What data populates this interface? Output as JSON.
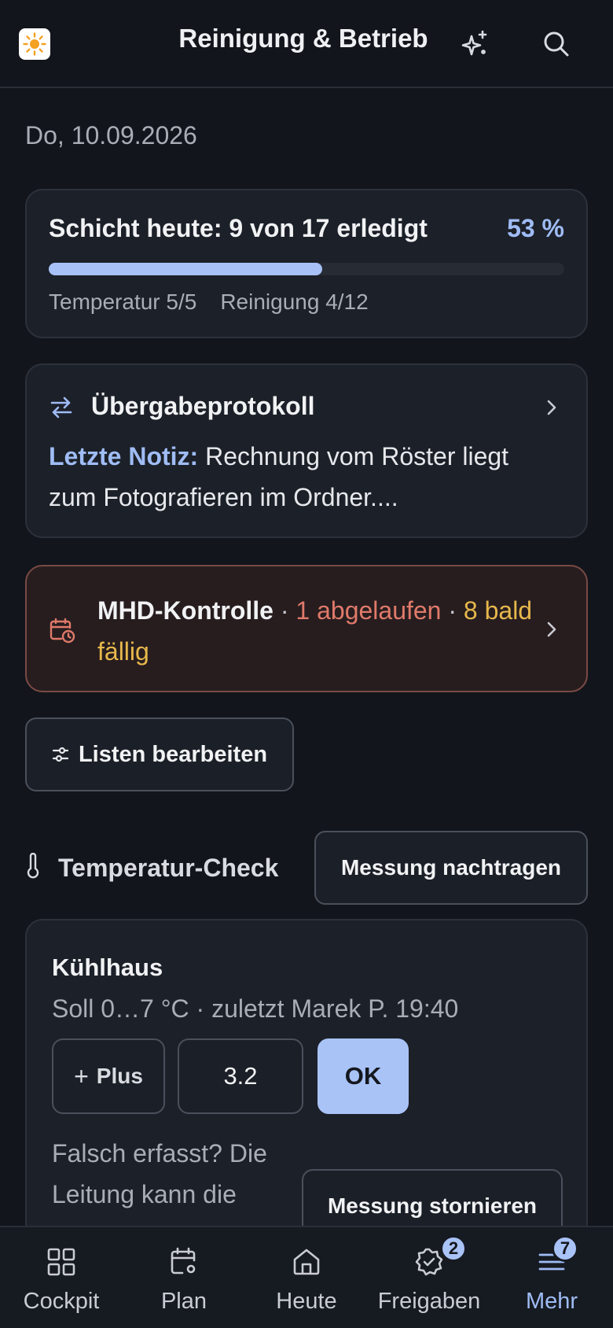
{
  "header": {
    "title": "Reinigung & Betrieb"
  },
  "date": "Do, 10.09.2026",
  "shift": {
    "title": "Schicht heute: 9 von 17 erledigt",
    "percent_label": "53 %",
    "progress": 0.53,
    "temperature": "Temperatur 5/5",
    "cleaning": "Reinigung 4/12"
  },
  "handover": {
    "title": "Übergabeprotokoll",
    "note_label": "Letzte Notiz:",
    "note_text": " Rechnung vom Röster liegt zum Fotografieren im Ordner...."
  },
  "mhd": {
    "title": "MHD-Kontrolle",
    "sep1": " · ",
    "expired": "1 abgelaufen",
    "sep2": " · ",
    "soon": "8 bald fällig"
  },
  "edit_lists_label": "Listen bearbeiten",
  "temperature_check": {
    "title": "Temperatur-Check",
    "add_button": "Messung nachtragen"
  },
  "cold_room": {
    "title": "Kühlhaus",
    "subtitle": "Soll 0…7 °C · zuletzt Marek P. 19:40",
    "plus_label": "Plus",
    "value": "3.2",
    "ok_label": "OK",
    "wrong_text": "Falsch erfasst? Die Leitung kann die Messung",
    "cancel_label": "Messung stornieren"
  },
  "nav": {
    "items": [
      {
        "label": "Cockpit"
      },
      {
        "label": "Plan"
      },
      {
        "label": "Heute"
      },
      {
        "label": "Freigaben",
        "badge": "2"
      },
      {
        "label": "Mehr",
        "badge": "7"
      }
    ]
  },
  "colors": {
    "background": "#12151b",
    "accent": "#9fbcf5",
    "expired": "#e07a6a",
    "warning": "#e7b84c"
  }
}
